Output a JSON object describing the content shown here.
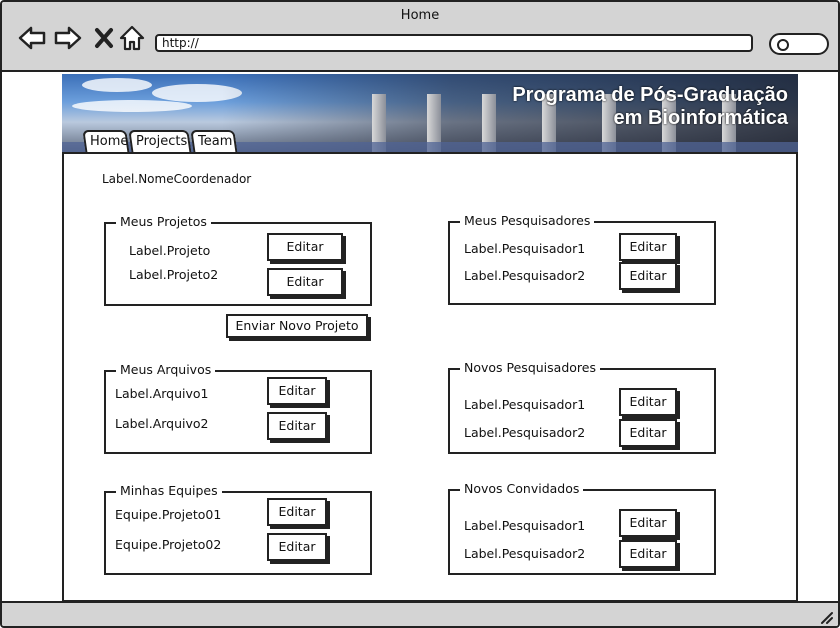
{
  "window": {
    "title": "Home"
  },
  "browser": {
    "address": "http://"
  },
  "banner": {
    "title_line1": "Programa de Pós-Graduação",
    "title_line2": "em Bioinformática"
  },
  "tabs": [
    {
      "label": "Home"
    },
    {
      "label": "Projects"
    },
    {
      "label": "Team"
    }
  ],
  "coordinator_label": "Label.NomeCoordenador",
  "meus_projetos": {
    "legend": "Meus Projetos",
    "items": [
      {
        "label": "Label.Projeto",
        "button": "Editar"
      },
      {
        "label": "Label.Projeto2",
        "button": "Editar"
      }
    ]
  },
  "send_project_button": "Enviar Novo Projeto",
  "meus_arquivos": {
    "legend": "Meus Arquivos",
    "items": [
      {
        "label": "Label.Arquivo1",
        "button": "Editar"
      },
      {
        "label": "Label.Arquivo2",
        "button": "Editar"
      }
    ]
  },
  "minhas_equipes": {
    "legend": "Minhas Equipes",
    "items": [
      {
        "label": "Equipe.Projeto01",
        "button": "Editar"
      },
      {
        "label": "Equipe.Projeto02",
        "button": "Editar"
      }
    ]
  },
  "meus_pesquisadores": {
    "legend": "Meus Pesquisadores",
    "items": [
      {
        "label": "Label.Pesquisador1",
        "button": "Editar"
      },
      {
        "label": "Label.Pesquisador2",
        "button": "Editar"
      }
    ]
  },
  "novos_pesquisadores": {
    "legend": "Novos Pesquisadores",
    "items": [
      {
        "label": "Label.Pesquisador1",
        "button": "Editar"
      },
      {
        "label": "Label.Pesquisador2",
        "button": "Editar"
      }
    ]
  },
  "novos_convidados": {
    "legend": "Novos Convidados",
    "items": [
      {
        "label": "Label.Pesquisador1",
        "button": "Editar"
      },
      {
        "label": "Label.Pesquisador2",
        "button": "Editar"
      }
    ]
  }
}
